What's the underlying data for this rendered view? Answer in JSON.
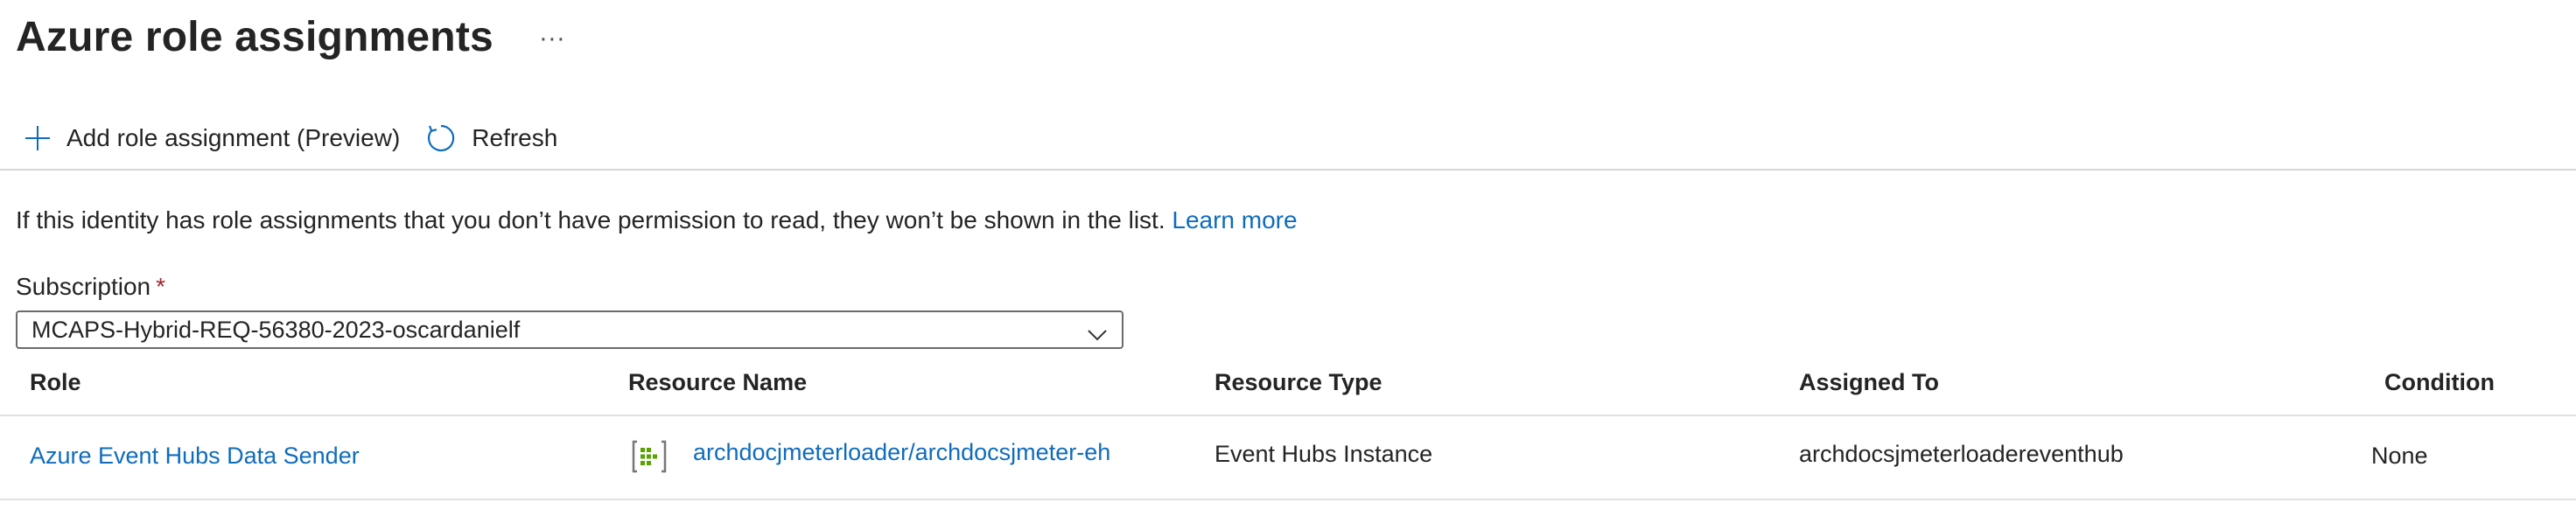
{
  "header": {
    "title": "Azure role assignments",
    "more_label": "···"
  },
  "toolbar": {
    "add_label": "Add role assignment (Preview)",
    "refresh_label": "Refresh"
  },
  "notice": {
    "text": "If this identity has role assignments that you don’t have permission to read, they won’t be shown in the list.",
    "link": "Learn more"
  },
  "subscription": {
    "label": "Subscription",
    "required_mark": "*",
    "selected": "MCAPS-Hybrid-REQ-56380-2023-oscardanielf"
  },
  "table": {
    "columns": [
      "Role",
      "Resource Name",
      "Resource Type",
      "Assigned To",
      "Condition"
    ],
    "rows": [
      {
        "role": "Azure Event Hubs Data Sender",
        "resource_name": "archdocjmeterloader/archdocsjmeter-eh",
        "resource_icon": "event-hubs-icon",
        "resource_type": "Event Hubs Instance",
        "assigned_to": "archdocsjmeterloadereventhub",
        "condition": "None"
      }
    ]
  },
  "colors": {
    "link": "#0f6cbd",
    "required": "#a4262c",
    "icon_green": "#57a300"
  }
}
